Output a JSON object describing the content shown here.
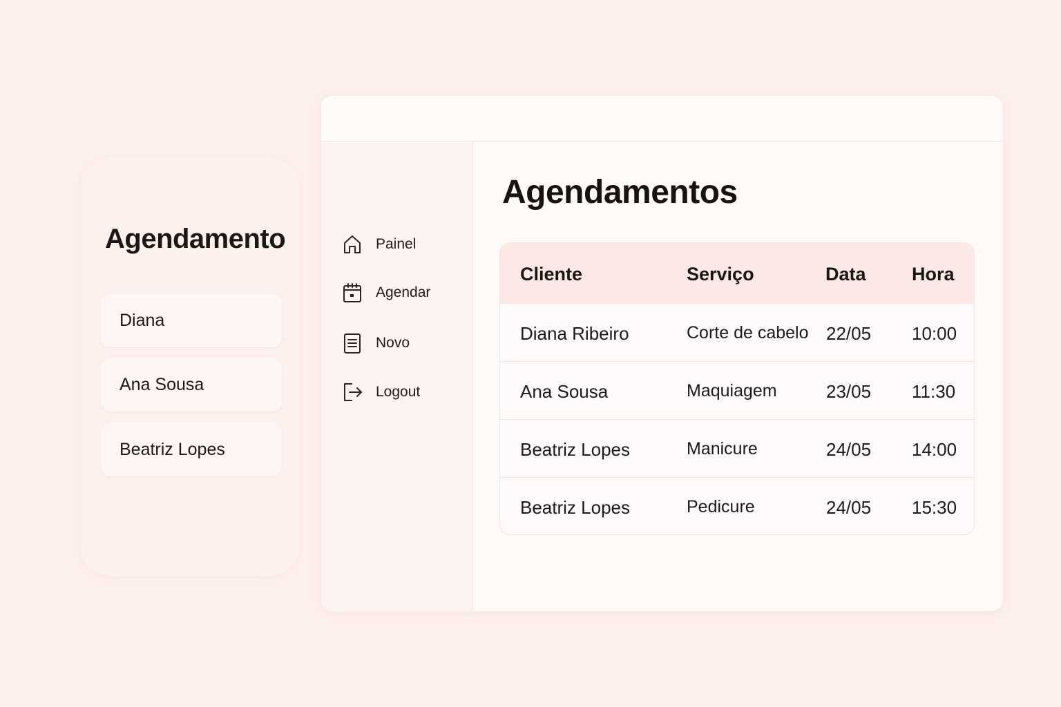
{
  "left_panel": {
    "title": "Agendamento",
    "clients": [
      "Diana",
      "Ana Sousa",
      "Beatriz Lopes"
    ]
  },
  "sidebar": {
    "items": [
      {
        "label": "Painel",
        "icon": "home-icon"
      },
      {
        "label": "Agendar",
        "icon": "calendar-icon"
      },
      {
        "label": "Novo",
        "icon": "document-icon"
      },
      {
        "label": "Logout",
        "icon": "logout-icon"
      }
    ]
  },
  "main": {
    "title": "Agendamentos",
    "table": {
      "headers": [
        "Cliente",
        "Serviço",
        "Data",
        "Hora"
      ],
      "rows": [
        [
          "Diana Ribeiro",
          "Corte de cabelo",
          "22/05",
          "10:00"
        ],
        [
          "Ana Sousa",
          "Maquiagem",
          "23/05",
          "11:30"
        ],
        [
          "Beatriz Lopes",
          "Manicure",
          "24/05",
          "14:00"
        ],
        [
          "Beatriz Lopes",
          "Pedicure",
          "24/05",
          "15:30"
        ]
      ]
    }
  },
  "colors": {
    "background": "#fdefec",
    "table_header": "#fce9e6",
    "sidebar": "#fdf3f0",
    "text": "#1e1a18"
  }
}
